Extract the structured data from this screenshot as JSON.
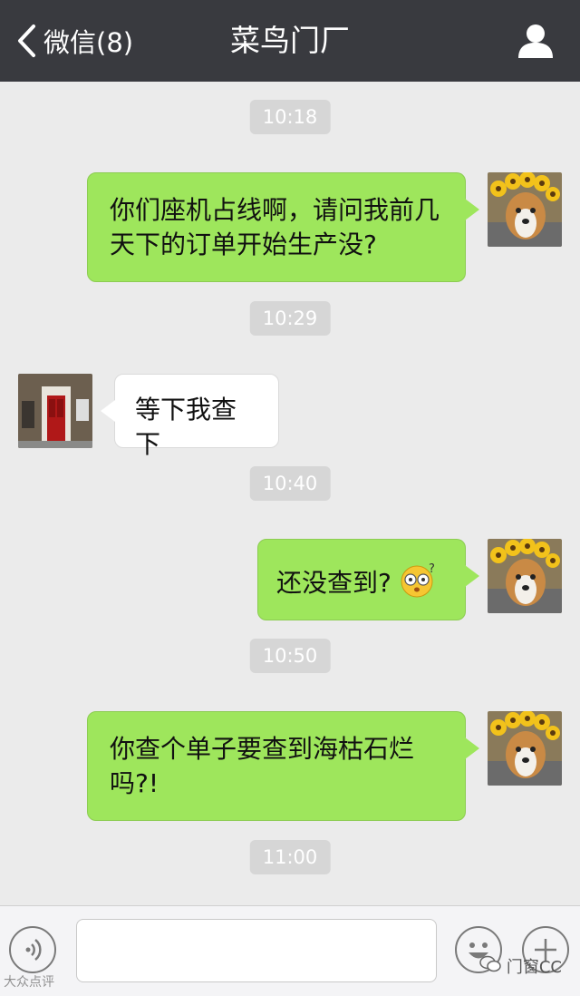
{
  "header": {
    "back_label": "微信(8)",
    "title": "菜鸟门厂",
    "profile_icon": "person-icon"
  },
  "messages": [
    {
      "type": "time",
      "text": "10:18"
    },
    {
      "type": "msg",
      "sender": "me",
      "text": "你们座机占线啊，请问我前几天下的订单开始生产没?"
    },
    {
      "type": "time",
      "text": "10:29"
    },
    {
      "type": "msg",
      "sender": "other",
      "text": "等下我查下"
    },
    {
      "type": "time",
      "text": "10:40"
    },
    {
      "type": "msg",
      "sender": "me",
      "text": "还没查到?",
      "emoji": "dizzy-face-emoji"
    },
    {
      "type": "time",
      "text": "10:50"
    },
    {
      "type": "msg",
      "sender": "me",
      "text": "你查个单子要查到海枯石烂吗?!"
    },
    {
      "type": "time",
      "text": "11:00"
    }
  ],
  "input_bar": {
    "text_value": "",
    "voice_icon": "voice-icon",
    "emoji_icon": "smiley-icon",
    "plus_icon": "plus-icon"
  },
  "watermarks": {
    "left": "大众点评",
    "right": "门窗CC"
  },
  "colors": {
    "header_bg": "#393a3f",
    "chat_bg": "#ebebeb",
    "my_bubble": "#9ee65c",
    "other_bubble": "#ffffff",
    "time_badge": "#d6d6d6"
  }
}
